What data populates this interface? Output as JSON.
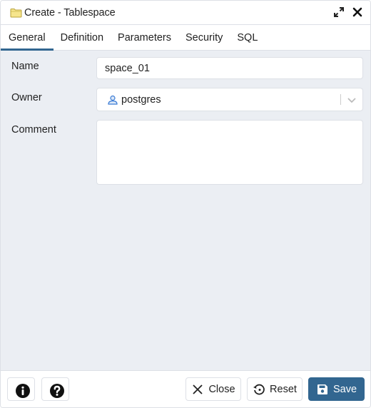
{
  "dialog": {
    "title": "Create - Tablespace",
    "title_icon": "folder-icon",
    "actions": [
      {
        "name": "maximize",
        "icon": "expand-icon"
      },
      {
        "name": "close",
        "icon": "close-icon"
      }
    ]
  },
  "tabs": [
    {
      "label": "General",
      "active": true
    },
    {
      "label": "Definition",
      "active": false
    },
    {
      "label": "Parameters",
      "active": false
    },
    {
      "label": "Security",
      "active": false
    },
    {
      "label": "SQL",
      "active": false
    }
  ],
  "form": {
    "name": {
      "label": "Name",
      "value": "space_01"
    },
    "owner": {
      "label": "Owner",
      "value": "postgres",
      "icon": "user-icon"
    },
    "comment": {
      "label": "Comment",
      "value": ""
    }
  },
  "footer": {
    "info_icon": "info-icon",
    "help_icon": "help-icon",
    "close_label": "Close",
    "reset_label": "Reset",
    "save_label": "Save"
  },
  "colors": {
    "accent": "#326690",
    "panel_bg": "#ebeef3",
    "border": "#dde0e6"
  }
}
